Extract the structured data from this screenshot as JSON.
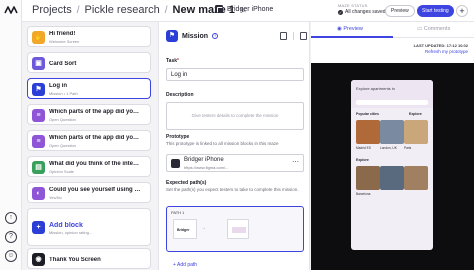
{
  "topbar": {
    "breadcrumbs": [
      "Projects",
      "Pickle research",
      "New maze 1"
    ],
    "prototype_name": "Bridger iPhone",
    "status_label": "MAZE STATUS",
    "status_text": "All changes saved",
    "preview_label": "Preview",
    "start_label": "Start testing",
    "add_label": "+",
    "gear": "⚙"
  },
  "blocks": [
    {
      "title": "Hi friend!",
      "subtitle": "Welcome Screen",
      "color": "#f0a72a",
      "glyph": "✋"
    },
    {
      "title": "Card Sort",
      "subtitle": "Card Sort",
      "color": "#6e59d9",
      "glyph": "▣"
    },
    {
      "title": "Log in",
      "subtitle": "Mission • 1 Path",
      "color": "#2b3fd6",
      "glyph": "⚑",
      "selected": true
    },
    {
      "title": "Which parts of the app did you like?",
      "subtitle": "Open Question",
      "color": "#8e55d6",
      "glyph": "≡"
    },
    {
      "title": "Which parts of the app did you like?",
      "subtitle": "Open Question",
      "color": "#8e55d6",
      "glyph": "≡"
    },
    {
      "title": "What did you think of the interface?",
      "subtitle": "Opinion Scale",
      "color": "#3a9f5c",
      "glyph": "▤"
    },
    {
      "title": "Could you see yourself using this app?",
      "subtitle": "Yes/No",
      "color": "#8e55d6",
      "glyph": "◐"
    },
    {
      "title": "Add block",
      "subtitle": "Mission, opinion rating...",
      "color": "#2b3fd6",
      "glyph": "+"
    },
    {
      "title": "Thank You Screen",
      "subtitle": "",
      "color": "#1d1d26",
      "glyph": "◉"
    }
  ],
  "editor": {
    "block_type": "Mission",
    "task_label": "Task",
    "task_required": "*",
    "task_value": "Log in",
    "description_label": "Description",
    "description_placeholder": "Give testers details to complete the mission",
    "prototype_label": "Prototype",
    "prototype_help": "This prototype is linked to all mission blocks in this maze",
    "prototype_name": "Bridger iPhone",
    "prototype_url": "https://www.figma.com/...",
    "expected_paths_label": "Expected path(s)",
    "expected_paths_help": "Set the path(s) you expect testers to take to complete this mission.",
    "path_label": "PATH 1",
    "path_screen_text": "Bridger",
    "add_path": "Add path"
  },
  "preview": {
    "tabs": [
      "Preview",
      "Comments"
    ],
    "updated": "LAST UPDATED: 17:12 10.02",
    "refresh": "Refresh my prototype",
    "phone_header": "Explore apartments in",
    "sections": [
      "Popular cities",
      "Explore"
    ],
    "cities": [
      "Madrid ES",
      "London, UK",
      "Paris",
      "Barcelona"
    ]
  }
}
